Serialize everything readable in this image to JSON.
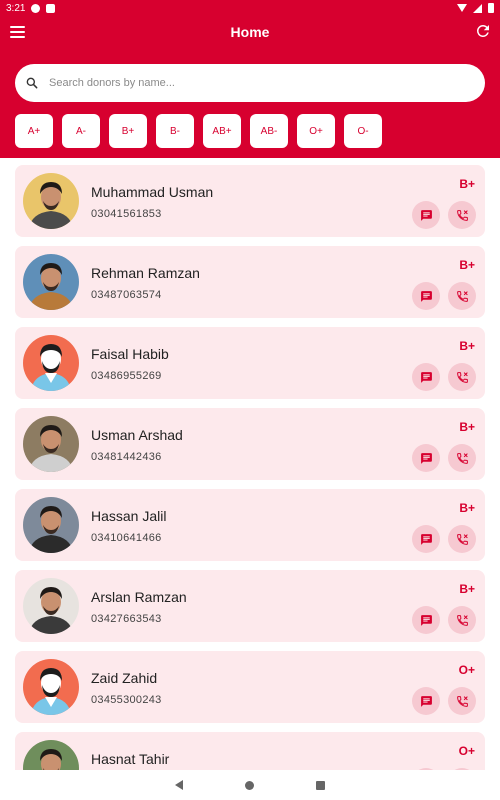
{
  "status_bar": {
    "time": "3:21"
  },
  "app": {
    "title": "Home"
  },
  "search": {
    "placeholder": "Search donors by name...",
    "value": ""
  },
  "filters": [
    "A+",
    "A-",
    "B+",
    "B-",
    "AB+",
    "AB-",
    "O+",
    "O-"
  ],
  "colors": {
    "primary": "#d7002f",
    "card": "#fde9ec",
    "action_bg": "#f6c9d1"
  },
  "donors": [
    {
      "name": "Muhammad Usman",
      "phone": "03041561853",
      "blood_group": "B+",
      "avatar": "photo"
    },
    {
      "name": "Rehman Ramzan",
      "phone": "03487063574",
      "blood_group": "B+",
      "avatar": "photo"
    },
    {
      "name": "Faisal Habib",
      "phone": "03486955269",
      "blood_group": "B+",
      "avatar": "placeholder"
    },
    {
      "name": "Usman Arshad",
      "phone": "03481442436",
      "blood_group": "B+",
      "avatar": "photo"
    },
    {
      "name": "Hassan Jalil",
      "phone": "03410641466",
      "blood_group": "B+",
      "avatar": "photo"
    },
    {
      "name": "Arslan Ramzan",
      "phone": "03427663543",
      "blood_group": "B+",
      "avatar": "photo"
    },
    {
      "name": "Zaid Zahid",
      "phone": "03455300243",
      "blood_group": "O+",
      "avatar": "placeholder"
    },
    {
      "name": "Hasnat Tahir",
      "phone": "",
      "blood_group": "O+",
      "avatar": "photo"
    }
  ],
  "icons": {
    "menu": "menu-icon",
    "refresh": "refresh-icon",
    "search": "search-icon",
    "message": "message-icon",
    "call": "phone-icon"
  }
}
